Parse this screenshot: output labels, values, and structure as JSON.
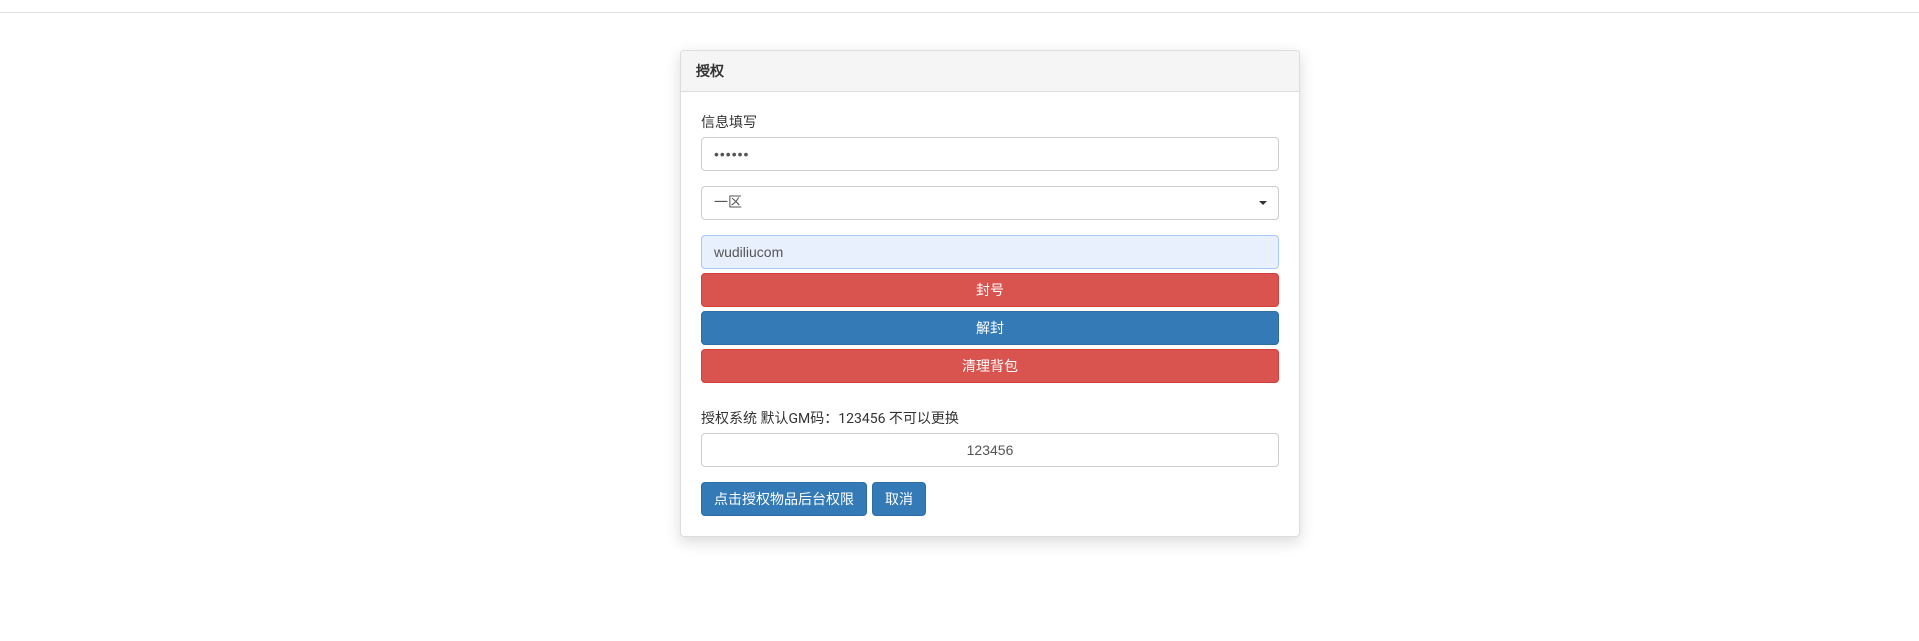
{
  "panel": {
    "title": "授权"
  },
  "form": {
    "info_label": "信息填写",
    "password_value": "······",
    "region_value": "一区",
    "username_value": "wudiliucom",
    "gm_label": "授权系统 默认GM码：123456 不可以更换",
    "gm_value": "123456"
  },
  "buttons": {
    "ban": "封号",
    "unban": "解封",
    "clear_bag": "清理背包",
    "authorize": "点击授权物品后台权限",
    "cancel": "取消"
  }
}
